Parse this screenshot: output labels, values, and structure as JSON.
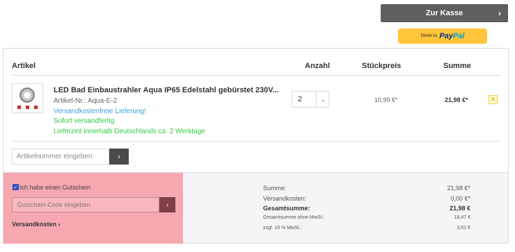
{
  "buttons": {
    "checkout_label": "Zur Kasse",
    "checkout_chevron": "›",
    "paypal_prefix": "Direkt zu",
    "paypal_brand_1": "Pay",
    "paypal_brand_2": "Pal"
  },
  "table": {
    "headers": [
      "Artikel",
      "Anzahl",
      "Stückpreis",
      "Summe"
    ]
  },
  "item": {
    "name": "LED Bad Einbaustrahler Aqua IP65 Edelstahl gebürstet 230V...",
    "article_number": "Artikel-Nr.: Aqua-E-2",
    "shipping_note": "Versandkostenfreie Lieferung!",
    "availability": "Sofort versandfertig",
    "delivery_time": "Lieferzeit innerhalb Deutschlands ca. 2 Werktage",
    "quantity": "2",
    "unit_price": "10,99 €*",
    "line_total": "21,98 €*",
    "remove_icon": "✕"
  },
  "add_article": {
    "placeholder": "Artikelnummer eingeben",
    "button_icon": "›"
  },
  "voucher": {
    "checkbox_label": "Ich habe einen Gutschein",
    "checked": true,
    "placeholder": "Gutschein-Code eingeben",
    "button_icon": "›",
    "shipping_link": "Versandkosten ›"
  },
  "summary": {
    "rows": [
      {
        "label": "Summe:",
        "value": "21,98 €*"
      },
      {
        "label": "Versandkosten:",
        "value": "0,00 €*"
      },
      {
        "label": "Gesamtsumme:",
        "value": "21,98 €"
      },
      {
        "label": "Gesamtsumme ohne MwSt.:",
        "value": "18,47 €"
      },
      {
        "label": "zzgl. 19 % MwSt.:",
        "value": "3,51 €"
      }
    ]
  },
  "colors": {
    "checkout_bg": "#5f5f5f",
    "paypal_bg": "#ffc439",
    "highlight_box": "#f6a8b0",
    "ship_text": "#3aa2d8",
    "available_text": "#2ecc40"
  }
}
